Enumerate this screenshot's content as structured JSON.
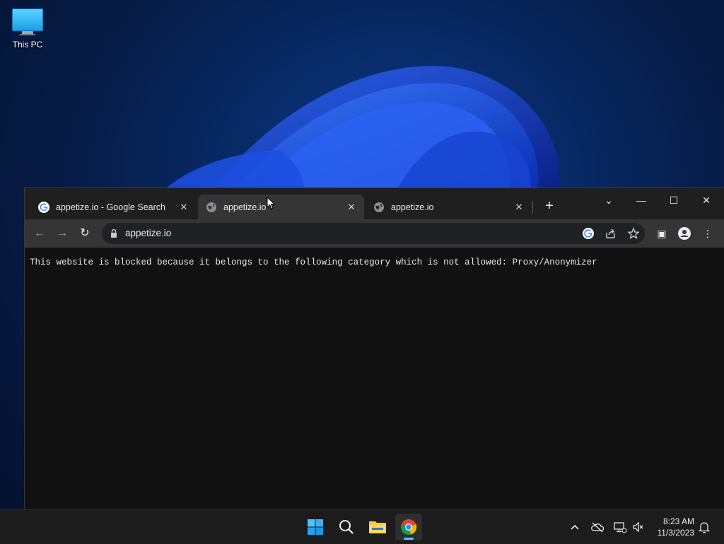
{
  "desktop": {
    "icons": [
      {
        "label": "This PC",
        "icon": "computer-icon"
      }
    ]
  },
  "browser": {
    "tabs": [
      {
        "title": "appetize.io - Google Search",
        "icon": "google-icon",
        "active": false
      },
      {
        "title": "appetize.io",
        "icon": "globe-icon",
        "active": true
      },
      {
        "title": "appetize.io",
        "icon": "globe-icon",
        "active": false
      }
    ],
    "close_glyph": "✕",
    "new_tab_glyph": "+",
    "window_controls": {
      "tab_search": "⌄",
      "minimize": "—",
      "maximize": "☐",
      "close": "✕"
    },
    "toolbar": {
      "back": "←",
      "forward": "→",
      "reload": "↻",
      "url": "appetize.io",
      "side_panel": "▣",
      "menu": "⋮"
    },
    "content": {
      "message": "This website is blocked because it belongs to the following category which is not allowed: Proxy/Anonymizer",
      "background": "#111111"
    }
  },
  "taskbar": {
    "apps": [
      "start-icon",
      "search-icon",
      "file-explorer-icon",
      "chrome-icon"
    ],
    "active_app": "chrome-icon",
    "tray": [
      "chevron-up-icon",
      "onedrive-icon",
      "network-icon",
      "volume-muted-icon"
    ],
    "clock": {
      "time": "8:23 AM",
      "date": "11/3/2023"
    },
    "notifications_icon": "bell-icon"
  },
  "colors": {
    "accent": "#5cc4ff",
    "tab_active": "#353535",
    "titlebar": "#1f1f1f",
    "omnibox": "#202124"
  }
}
